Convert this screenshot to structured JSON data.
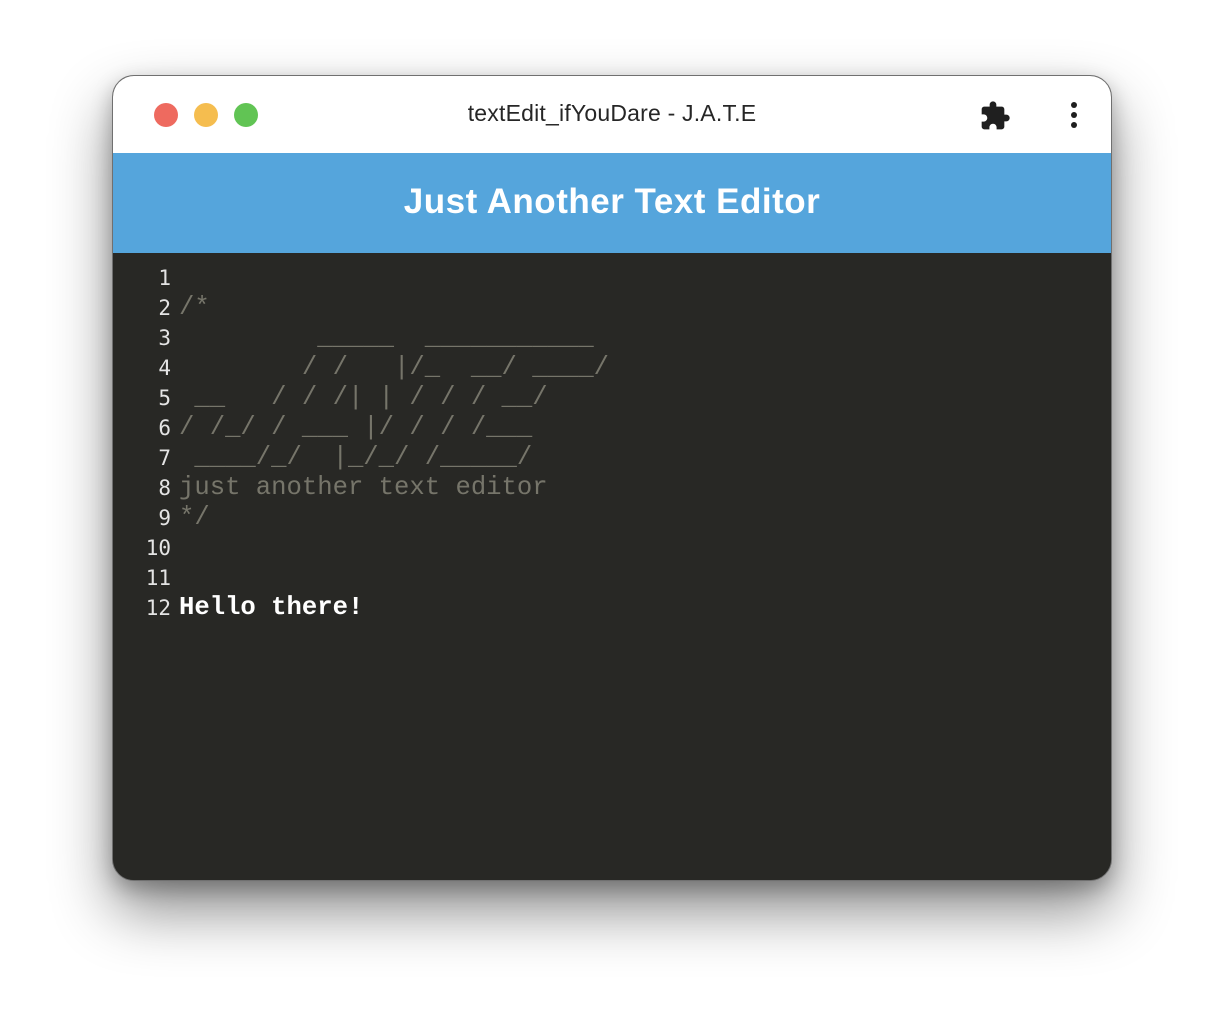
{
  "window": {
    "title": "textEdit_ifYouDare - J.A.T.E"
  },
  "header": {
    "title": "Just Another Text Editor"
  },
  "editor": {
    "line_numbers": [
      "1",
      "2",
      "3",
      "4",
      "5",
      "6",
      "7",
      "8",
      "9",
      "10",
      "11",
      "12"
    ],
    "lines": [
      "",
      "/*",
      "         _____  ___________",
      "        / /   |/_  __/ ____/",
      " __   / / /| | / / / __/",
      "/ /_/ / ___ |/ / / /___",
      " ____/_/  |_/_/ /_____/",
      "just another text editor",
      "*/",
      "",
      "",
      "Hello there!"
    ]
  },
  "colors": {
    "header_bg": "#55a5dc",
    "editor_bg": "#282825",
    "comment": "#76756a",
    "text": "#ffffff",
    "close": "#ee6a5f",
    "minimize": "#f5bd4f",
    "maximize": "#61c454"
  },
  "icons": {
    "extensions": "puzzle-icon",
    "menu": "more-vertical-icon"
  }
}
